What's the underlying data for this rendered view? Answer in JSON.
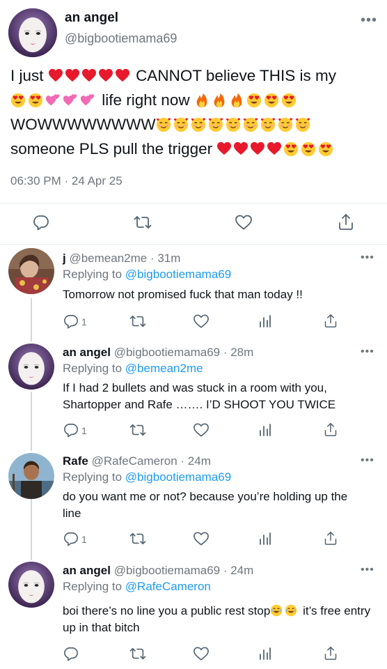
{
  "main_tweet": {
    "author_name": "an angel",
    "author_handle": "@bigbootiemama69",
    "line1_a": "I just",
    "line1_b": "CANNOT believe THIS is my",
    "line2_a": "life right now",
    "line3_a": "WOWWWWWWWW",
    "line4_a": "someone PLS pull the trigger",
    "timestamp": "06:30 PM · 24 Apr 25",
    "more_icon": "more-horizontal-icon"
  },
  "actions": [
    "reply-icon",
    "retweet-icon",
    "like-icon",
    "share-icon"
  ],
  "replies": [
    {
      "name": "j",
      "handle": "@bemean2me",
      "time": "· 31m",
      "replying_label": "Replying to",
      "replying_to": "@bigbootiemama69",
      "text": "Tomorrow not promised fuck that man today !!",
      "reply_count": "1"
    },
    {
      "name": "an angel",
      "handle": "@bigbootiemama69",
      "time": "· 28m",
      "replying_label": "Replying to",
      "replying_to": "@bemean2me",
      "text": "If I had 2 bullets and was stuck in a room with you, Shartopper and Rafe ……. I’D SHOOT YOU TWICE",
      "reply_count": "1"
    },
    {
      "name": "Rafe",
      "handle": "@RafeCameron",
      "time": "· 24m",
      "replying_label": "Replying to",
      "replying_to": "@bigbootiemama69",
      "text": "do you want me or not? because you’re holding up the line",
      "reply_count": "1"
    },
    {
      "name": "an angel",
      "handle": "@bigbootiemama69",
      "time": "· 24m",
      "replying_label": "Replying to",
      "replying_to": "@RafeCameron",
      "text_a": "boi there’s no line you a public rest stop",
      "text_b": "it’s free entry up in that bitch",
      "reply_count": ""
    }
  ],
  "colors": {
    "accent": "#1d9bf0",
    "muted": "#6e767d",
    "divider": "#e6ecf0",
    "heart": "#e8192c"
  }
}
